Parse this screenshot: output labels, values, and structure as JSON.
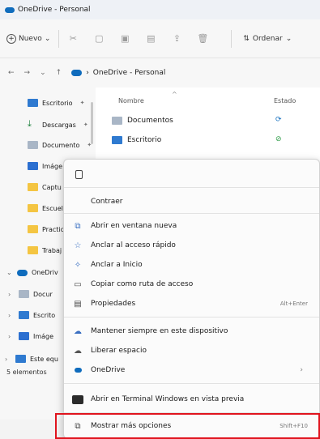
{
  "window": {
    "title": "OneDrive - Personal"
  },
  "toolbar": {
    "new_label": "Nuevo",
    "sort_label": "Ordenar"
  },
  "address": {
    "path": "OneDrive - Personal"
  },
  "sidebar": {
    "items": [
      {
        "label": "Escritorio",
        "icon": "desktop-folder-icon"
      },
      {
        "label": "Descargas",
        "icon": "download-icon"
      },
      {
        "label": "Documento",
        "icon": "documents-icon"
      },
      {
        "label": "Imáge",
        "icon": "pictures-icon"
      },
      {
        "label": "Captu",
        "icon": "folder-icon"
      },
      {
        "label": "Escuel",
        "icon": "folder-icon"
      },
      {
        "label": "Practic",
        "icon": "folder-icon"
      },
      {
        "label": "Trabaj",
        "icon": "folder-icon"
      },
      {
        "label": "OneDriv",
        "icon": "onedrive-cloud-icon"
      },
      {
        "label": "Docur",
        "icon": "documents-icon"
      },
      {
        "label": "Escrito",
        "icon": "desktop-folder-icon"
      },
      {
        "label": "Imáge",
        "icon": "pictures-icon"
      },
      {
        "label": "Este equ",
        "icon": "this-pc-icon"
      }
    ]
  },
  "files": {
    "columns": {
      "name": "Nombre",
      "state": "Estado"
    },
    "rows": [
      {
        "name": "Documentos",
        "state_icon": "sync-icon"
      },
      {
        "name": "Escritorio",
        "state_icon": "available-check-icon"
      }
    ]
  },
  "status": {
    "count": "5 elementos"
  },
  "context_menu": {
    "contraer": "Contraer",
    "abrir_ventana": "Abrir en ventana nueva",
    "anclar_rapido": "Anclar al acceso rápido",
    "anclar_inicio": "Anclar a Inicio",
    "copiar_ruta": "Copiar como ruta de acceso",
    "propiedades": "Propiedades",
    "propiedades_shortcut": "Alt+Enter",
    "mantener": "Mantener siempre en este dispositivo",
    "liberar": "Liberar espacio",
    "onedrive": "OneDrive",
    "terminal": "Abrir en Terminal Windows en vista previa",
    "mas_opciones": "Mostrar más opciones",
    "mas_opciones_shortcut": "Shift+F10"
  },
  "colors": {
    "accent": "#0f6cbd",
    "highlight_box": "#e0141e"
  }
}
